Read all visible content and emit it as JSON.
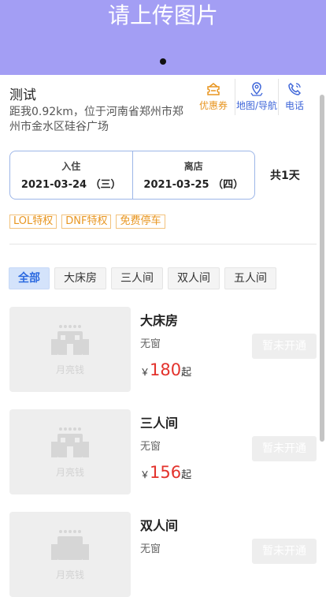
{
  "banner": {
    "placeholder_text": "请上传图片"
  },
  "hotel": {
    "name": "测试",
    "address": "距我0.92km，位于河南省郑州市郑州市金水区硅谷广场"
  },
  "actions": [
    {
      "label": "优惠券",
      "icon": "coupon-icon"
    },
    {
      "label": "地图/导航",
      "icon": "map-pin-icon"
    },
    {
      "label": "电话",
      "icon": "phone-icon"
    }
  ],
  "dates": {
    "checkin_label": "入住",
    "checkin_value": "2021-03-24 （三）",
    "checkout_label": "离店",
    "checkout_value": "2021-03-25 （四）",
    "nights": "共1天"
  },
  "tags": [
    "LOL特权",
    "DNF特权",
    "免费停车"
  ],
  "filters": [
    "全部",
    "大床房",
    "三人间",
    "双人间",
    "五人间"
  ],
  "rooms": [
    {
      "name": "大床房",
      "window": "无窗",
      "currency": "￥",
      "price": "180",
      "suffix": "起",
      "button": "暂未开通",
      "thumb_label": "月亮钱"
    },
    {
      "name": "三人间",
      "window": "无窗",
      "currency": "￥",
      "price": "156",
      "suffix": "起",
      "button": "暂未开通",
      "thumb_label": "月亮钱"
    },
    {
      "name": "双人间",
      "window": "无窗",
      "currency": "￥",
      "price": "",
      "suffix": "",
      "button": "暂未开通",
      "thumb_label": "月亮钱"
    }
  ],
  "colors": {
    "banner": "#a39ef4",
    "accent_blue": "#3f66d9",
    "accent_orange": "#e89621",
    "price_red": "#e3322c"
  }
}
